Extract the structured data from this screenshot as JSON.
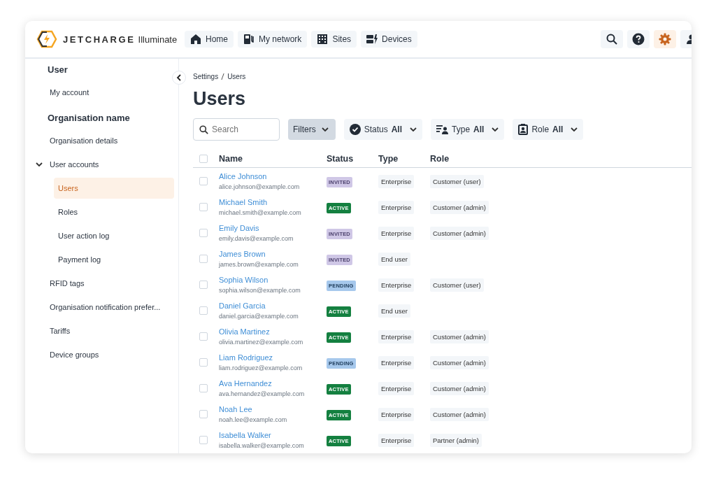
{
  "header": {
    "logo": {
      "brand": "JETCHARGE",
      "product": "Illuminate"
    },
    "nav": [
      {
        "label": "Home"
      },
      {
        "label": "My network"
      },
      {
        "label": "Sites"
      },
      {
        "label": "Devices"
      }
    ],
    "actions": [
      {
        "selected": false
      },
      {
        "selected": false
      },
      {
        "selected": true
      },
      {
        "selected": false
      }
    ]
  },
  "sidebar": {
    "sections": [
      {
        "heading": "User",
        "items": [
          {
            "label": "My account",
            "selected": false
          }
        ]
      },
      {
        "heading": "Organisation name",
        "items": [
          {
            "label": "Organisation details",
            "selected": false
          },
          {
            "label": "User accounts",
            "selected": false,
            "expanded": true,
            "children": [
              {
                "label": "Users",
                "selected": true
              },
              {
                "label": "Roles",
                "selected": false
              },
              {
                "label": "User action log",
                "selected": false
              },
              {
                "label": "Payment log",
                "selected": false
              }
            ]
          },
          {
            "label": "RFID tags",
            "selected": false
          },
          {
            "label": "Organisation notification prefer...",
            "selected": false
          },
          {
            "label": "Tariffs",
            "selected": false
          },
          {
            "label": "Device groups",
            "selected": false
          }
        ]
      }
    ]
  },
  "breadcrumb": [
    "Settings",
    "Users"
  ],
  "page_title": "Users",
  "search": {
    "placeholder": "Search"
  },
  "filters_button": "Filters",
  "filters": [
    {
      "label": "Status",
      "value": "All"
    },
    {
      "label": "Type",
      "value": "All"
    },
    {
      "label": "Role",
      "value": "All"
    }
  ],
  "table": {
    "select_all_checked": false,
    "columns": [
      "Name",
      "Status",
      "Type",
      "Role"
    ],
    "rows": [
      {
        "checked": false,
        "name": "Alice Johnson",
        "email": "alice.johnson@example.com",
        "status": "INVITED",
        "kind": "invited",
        "type": "Enterprise",
        "role": "Customer (user)"
      },
      {
        "checked": false,
        "name": "Michael Smith",
        "email": "michael.smith@example.com",
        "status": "ACTIVE",
        "kind": "active",
        "type": "Enterprise",
        "role": "Customer (admin)"
      },
      {
        "checked": false,
        "name": "Emily Davis",
        "email": "emily.davis@example.com",
        "status": "INVITED",
        "kind": "invited",
        "type": "Enterprise",
        "role": "Customer (admin)"
      },
      {
        "checked": false,
        "name": "James Brown",
        "email": "james.brown@example.com",
        "status": "INVITED",
        "kind": "invited",
        "type": "End user"
      },
      {
        "checked": false,
        "name": "Sophia Wilson",
        "email": "sophia.wilson@example.com",
        "status": "PENDING",
        "kind": "pending",
        "type": "Enterprise",
        "role": "Customer (user)"
      },
      {
        "checked": false,
        "name": "Daniel Garcia",
        "email": "daniel.garcia@example.com",
        "status": "ACTIVE",
        "kind": "active",
        "type": "End user"
      },
      {
        "checked": false,
        "name": "Olivia Martinez",
        "email": "olivia.martinez@example.com",
        "status": "ACTIVE",
        "kind": "active",
        "type": "Enterprise",
        "role": "Customer (admin)"
      },
      {
        "checked": false,
        "name": "Liam Rodriguez",
        "email": "liam.rodriguez@example.com",
        "status": "PENDING",
        "kind": "pending",
        "type": "Enterprise",
        "role": "Customer (admin)"
      },
      {
        "checked": false,
        "name": "Ava Hernandez",
        "email": "ava.hernandez@example.com",
        "status": "ACTIVE",
        "kind": "active",
        "type": "Enterprise",
        "role": "Customer (admin)"
      },
      {
        "checked": false,
        "name": "Noah Lee",
        "email": "noah.lee@example.com",
        "status": "ACTIVE",
        "kind": "active",
        "type": "Enterprise",
        "role": "Customer (admin)"
      },
      {
        "checked": false,
        "name": "Isabella Walker",
        "email": "isabella.walker@example.com",
        "status": "ACTIVE",
        "kind": "active",
        "type": "Enterprise",
        "role": "Partner (admin)"
      }
    ]
  }
}
